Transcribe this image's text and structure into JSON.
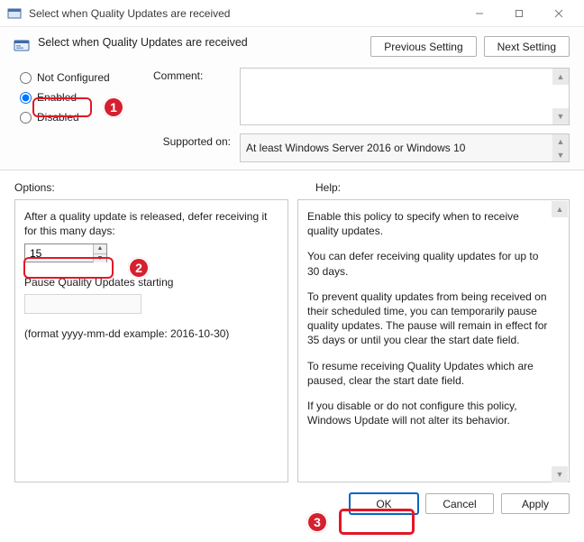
{
  "window": {
    "title": "Select when Quality Updates are received"
  },
  "header": {
    "policy_title": "Select when Quality Updates are received",
    "prev_label": "Previous Setting",
    "next_label": "Next Setting"
  },
  "config": {
    "radios": {
      "not_configured": "Not Configured",
      "enabled": "Enabled",
      "disabled": "Disabled",
      "selected": "enabled"
    },
    "comment_label": "Comment:",
    "comment_value": "",
    "supported_label": "Supported on:",
    "supported_value": "At least Windows Server 2016 or Windows 10"
  },
  "sections": {
    "options_label": "Options:",
    "help_label": "Help:"
  },
  "options": {
    "defer_label": "After a quality update is released, defer receiving it for this many days:",
    "defer_value": "15",
    "pause_label": "Pause Quality Updates starting",
    "pause_value": "",
    "format_hint": "(format yyyy-mm-dd example: 2016-10-30)"
  },
  "help": {
    "p1": "Enable this policy to specify when to receive quality updates.",
    "p2": "You can defer receiving quality updates for up to 30 days.",
    "p3": "To prevent quality updates from being received on their scheduled time, you can temporarily pause quality updates. The pause will remain in effect for 35 days or until you clear the start date field.",
    "p4": "To resume receiving Quality Updates which are paused, clear the start date field.",
    "p5": "If you disable or do not configure this policy, Windows Update will not alter its behavior."
  },
  "footer": {
    "ok": "OK",
    "cancel": "Cancel",
    "apply": "Apply"
  },
  "callouts": {
    "c1": "1",
    "c2": "2",
    "c3": "3"
  }
}
